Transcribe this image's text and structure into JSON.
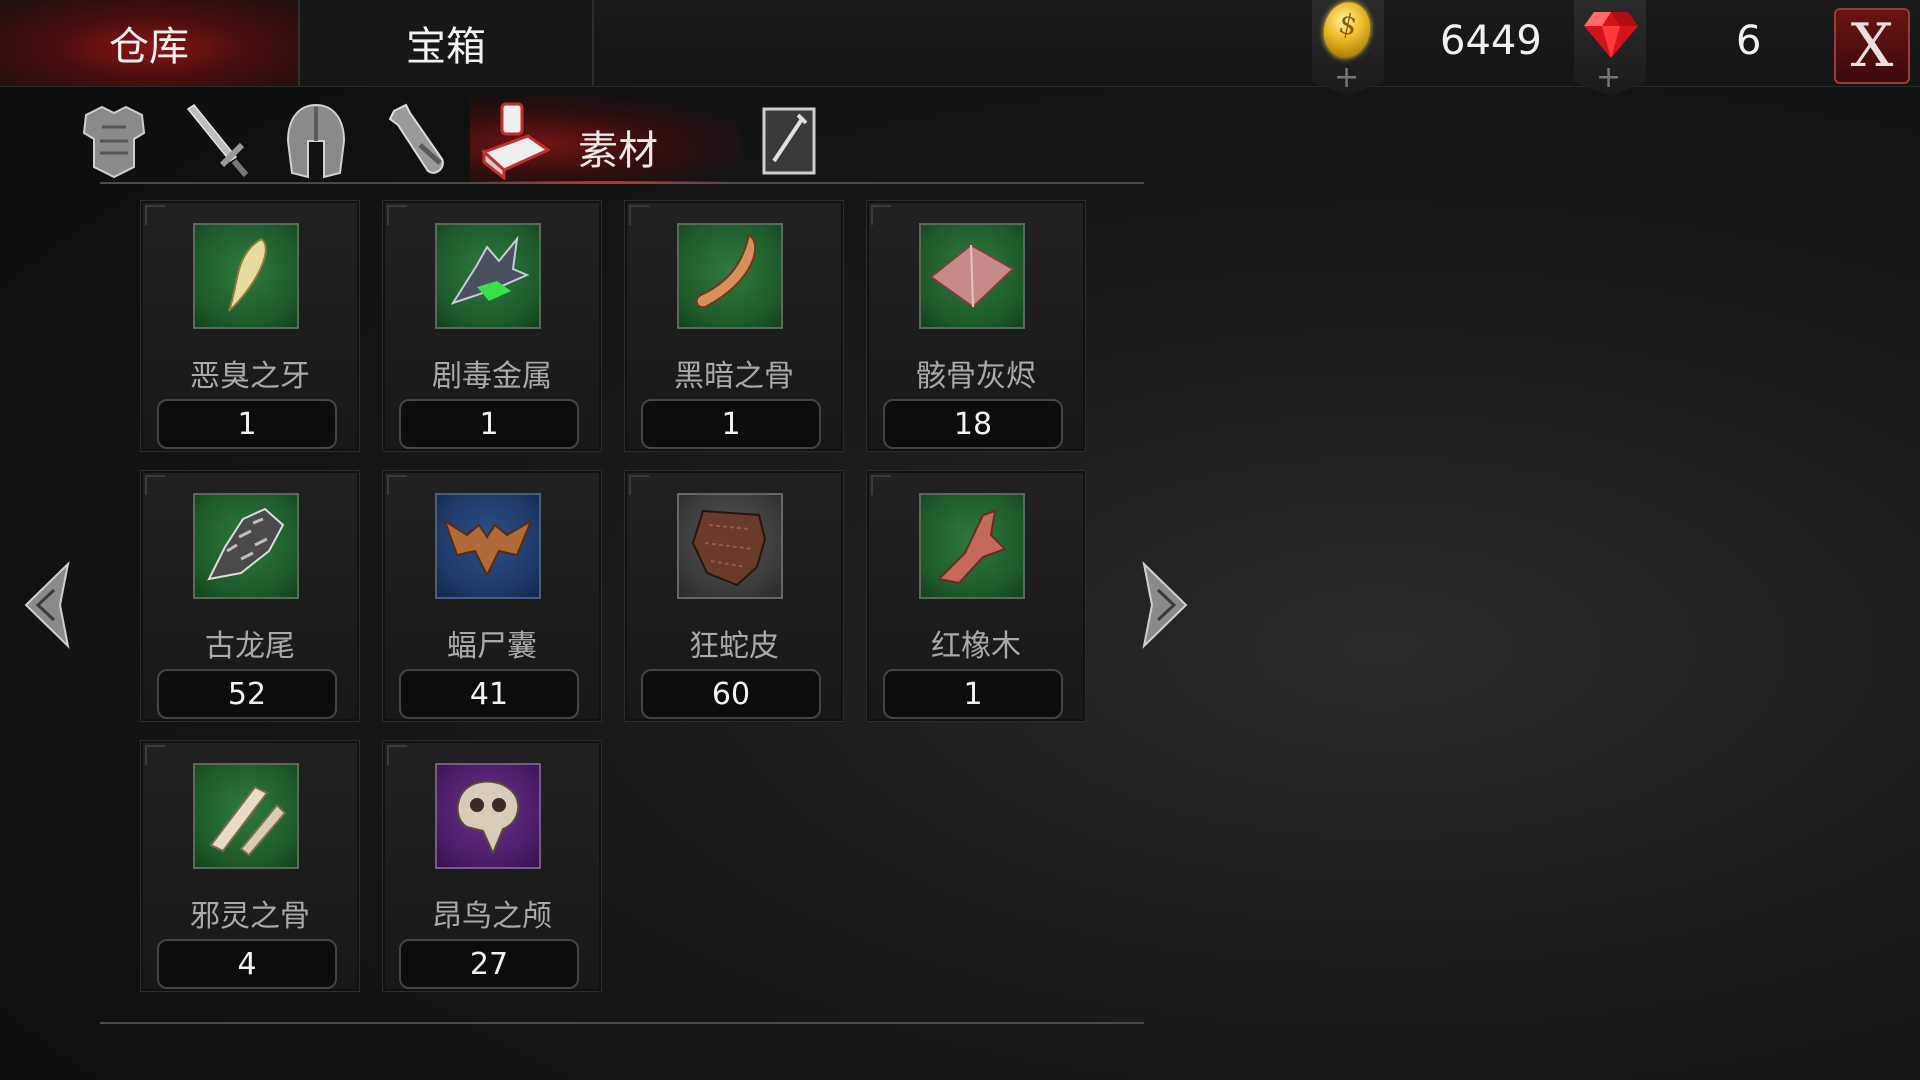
{
  "tabs": {
    "warehouse": "仓库",
    "chest": "宝箱"
  },
  "currency": {
    "gold": "6449",
    "gems": "6",
    "coin_icon": "gold-coin-icon",
    "gem_icon": "ruby-gem-icon"
  },
  "close_label": "X",
  "categories": {
    "active_label": "素材",
    "icons": [
      "armor-icon",
      "sword-icon",
      "helmet-icon",
      "potion-icon",
      "material-icon",
      "scroll-icon"
    ]
  },
  "items": [
    {
      "name": "恶臭之牙",
      "count": "1",
      "rarity": "green",
      "icon": "fang-icon"
    },
    {
      "name": "剧毒金属",
      "count": "1",
      "rarity": "green",
      "icon": "toxic-metal-icon"
    },
    {
      "name": "黑暗之骨",
      "count": "1",
      "rarity": "green",
      "icon": "dark-bone-icon"
    },
    {
      "name": "骸骨灰烬",
      "count": "18",
      "rarity": "green",
      "icon": "bone-ash-icon"
    },
    {
      "name": "古龙尾",
      "count": "52",
      "rarity": "green",
      "icon": "dragon-tail-icon"
    },
    {
      "name": "蝠尸囊",
      "count": "41",
      "rarity": "blue",
      "icon": "bat-corpse-icon"
    },
    {
      "name": "狂蛇皮",
      "count": "60",
      "rarity": "gray",
      "icon": "snake-skin-icon"
    },
    {
      "name": "红橡木",
      "count": "1",
      "rarity": "green",
      "icon": "red-oak-icon"
    },
    {
      "name": "邪灵之骨",
      "count": "4",
      "rarity": "green",
      "icon": "evil-bone-icon"
    },
    {
      "name": "昂鸟之颅",
      "count": "27",
      "rarity": "purple",
      "icon": "bird-skull-icon"
    }
  ],
  "colors": {
    "active_tab": "#8a1515",
    "rarity_green": "#2f7a3e",
    "rarity_blue": "#2c4f8a",
    "rarity_gray": "#555555",
    "rarity_purple": "#6a2f8a"
  }
}
